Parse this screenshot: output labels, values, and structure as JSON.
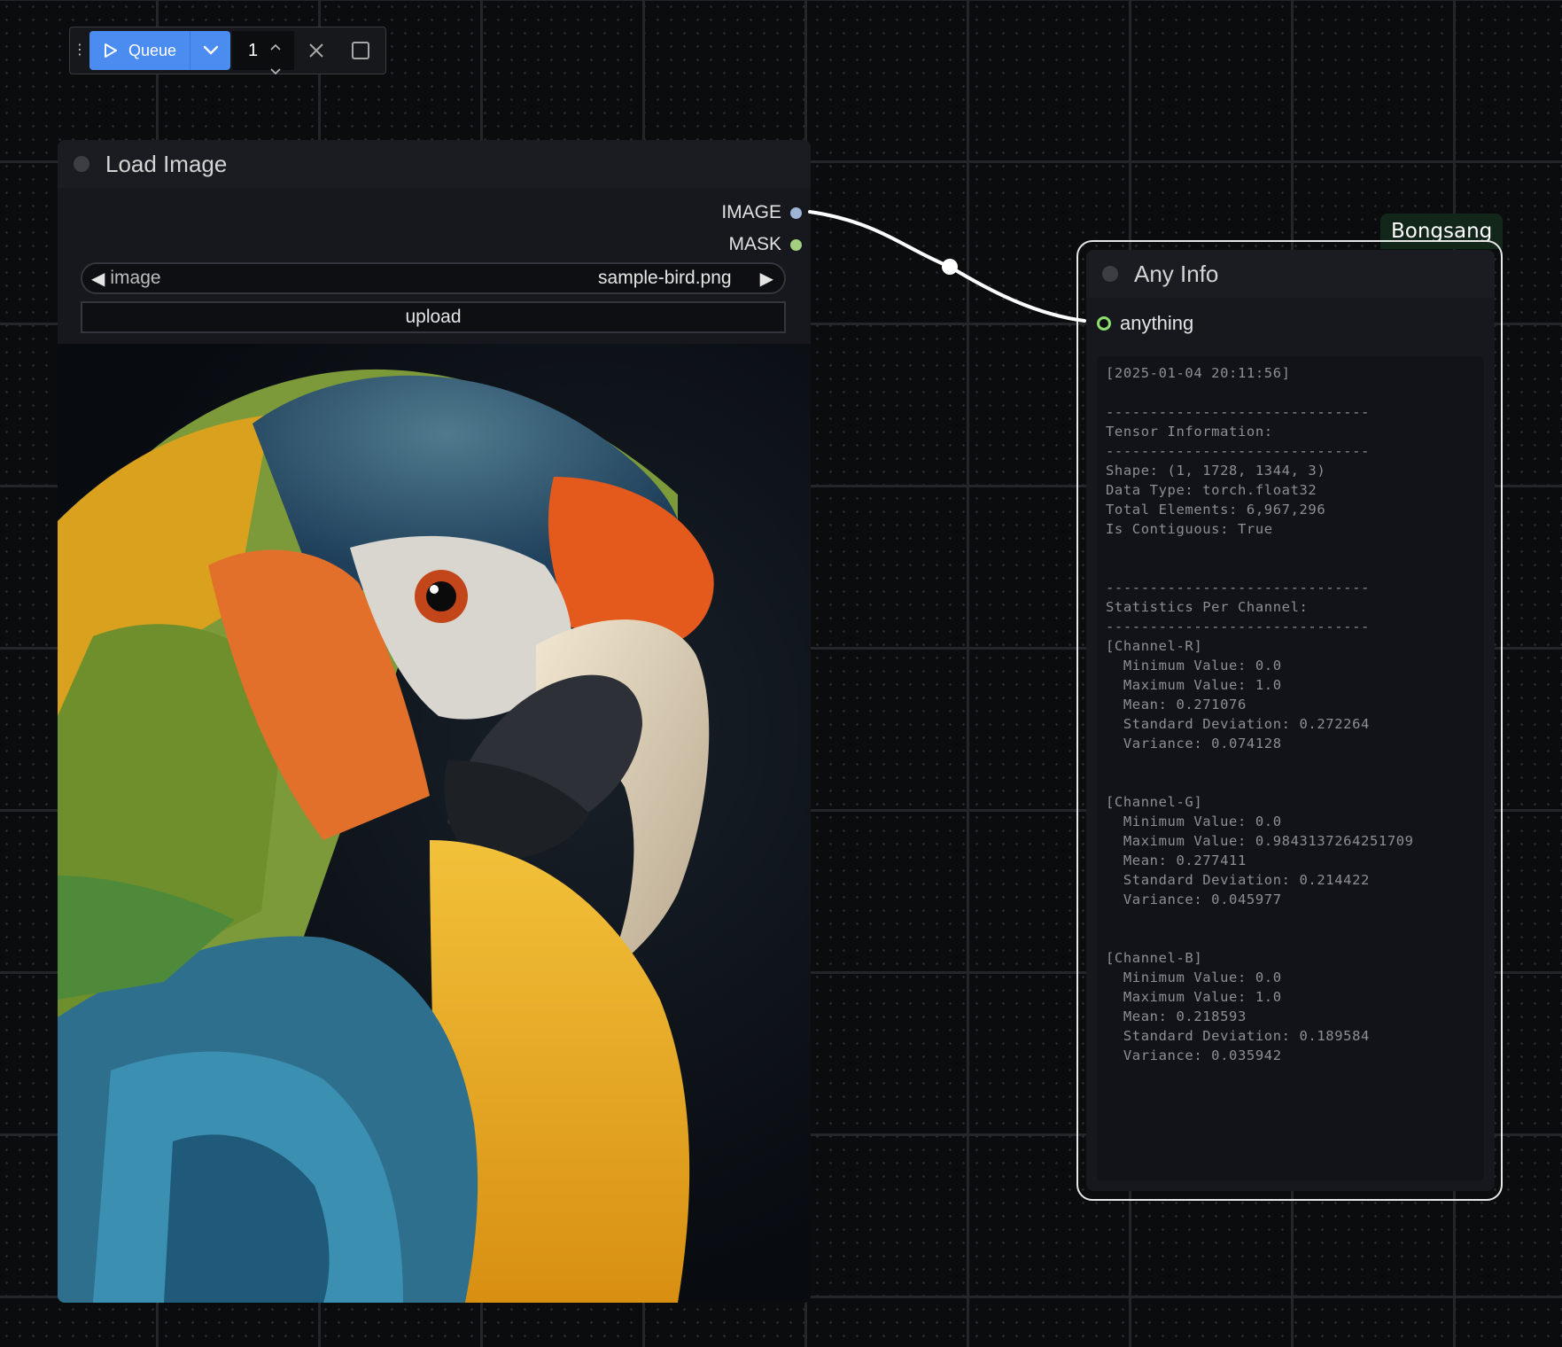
{
  "toolbar": {
    "drag_handle": "⋮",
    "queue_label": "Queue",
    "batch_count": "1"
  },
  "load_image_node": {
    "title": "Load Image",
    "outputs": [
      {
        "label": "IMAGE",
        "color": "#9fb3d4"
      },
      {
        "label": "MASK",
        "color": "#a3cf7e"
      }
    ],
    "image_widget": {
      "label": "image",
      "value": "sample-bird.png"
    },
    "upload_label": "upload"
  },
  "any_info_node": {
    "group_label": "Bongsang",
    "title": "Any Info",
    "input_label": "anything",
    "input_color": "#8ee06e",
    "info_text": "[2025-01-04 20:11:56]\n\n------------------------------\nTensor Information:\n------------------------------\nShape: (1, 1728, 1344, 3)\nData Type: torch.float32\nTotal Elements: 6,967,296\nIs Contiguous: True\n\n\n------------------------------\nStatistics Per Channel:\n------------------------------\n[Channel-R]\n  Minimum Value: 0.0\n  Maximum Value: 1.0\n  Mean: 0.271076\n  Standard Deviation: 0.272264\n  Variance: 0.074128\n\n\n[Channel-G]\n  Minimum Value: 0.0\n  Maximum Value: 0.9843137264251709\n  Mean: 0.277411\n  Standard Deviation: 0.214422\n  Variance: 0.045977\n\n\n[Channel-B]\n  Minimum Value: 0.0\n  Maximum Value: 1.0\n  Mean: 0.218593\n  Standard Deviation: 0.189584\n  Variance: 0.035942"
  },
  "colors": {
    "accent": "#4a8cf0",
    "wire": "#ffffff"
  }
}
